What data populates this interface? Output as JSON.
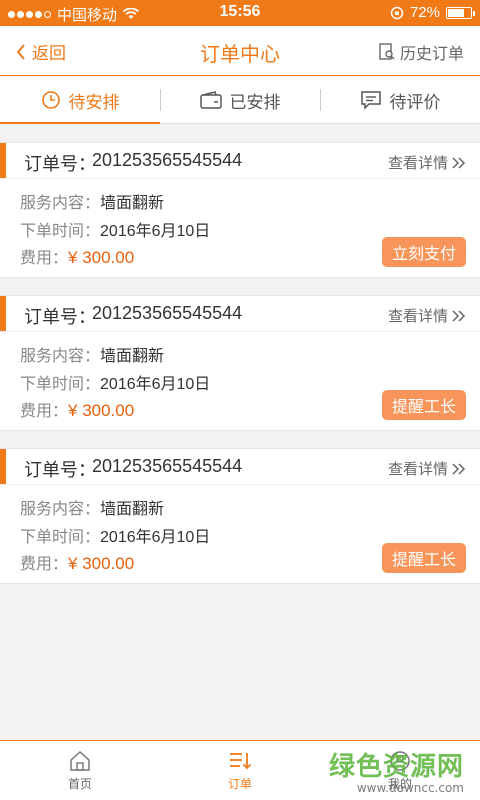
{
  "status_bar": {
    "carrier": "中国移动",
    "time": "15:56",
    "battery": "72%",
    "battery_level": 0.72
  },
  "header": {
    "back_label": "返回",
    "title": "订单中心",
    "history_label": "历史订单"
  },
  "tabs": [
    {
      "label": "待安排",
      "icon": "clock-icon"
    },
    {
      "label": "已安排",
      "icon": "wallet-icon"
    },
    {
      "label": "待评价",
      "icon": "comment-icon"
    }
  ],
  "orders": [
    {
      "order_no_label": "订单号：",
      "order_no": "201253565545544",
      "detail_label": "查看详情",
      "service_label": "服务内容：",
      "service": "墙面翻新",
      "time_label": "下单时间：",
      "time": "2016年6月10日",
      "fee_label": "费用：",
      "fee": "¥ 300.00",
      "action": "立刻支付"
    },
    {
      "order_no_label": "订单号：",
      "order_no": "201253565545544",
      "detail_label": "查看详情",
      "service_label": "服务内容：",
      "service": "墙面翻新",
      "time_label": "下单时间：",
      "time": "2016年6月10日",
      "fee_label": "费用：",
      "fee": "¥ 300.00",
      "action": "提醒工长"
    },
    {
      "order_no_label": "订单号：",
      "order_no": "201253565545544",
      "detail_label": "查看详情",
      "service_label": "服务内容：",
      "service": "墙面翻新",
      "time_label": "下单时间：",
      "time": "2016年6月10日",
      "fee_label": "费用：",
      "fee": "¥ 300.00",
      "action": "提醒工长"
    }
  ],
  "bottom_nav": [
    {
      "label": "首页",
      "icon": "home-icon"
    },
    {
      "label": "订单",
      "icon": "order-list-icon"
    },
    {
      "label": "我的",
      "icon": "profile-icon"
    }
  ],
  "watermark": {
    "text": "绿色资源网",
    "url": "www.downcc.com"
  },
  "colors": {
    "accent": "#f07a18",
    "button": "#f7955a",
    "price": "#e8600c"
  }
}
